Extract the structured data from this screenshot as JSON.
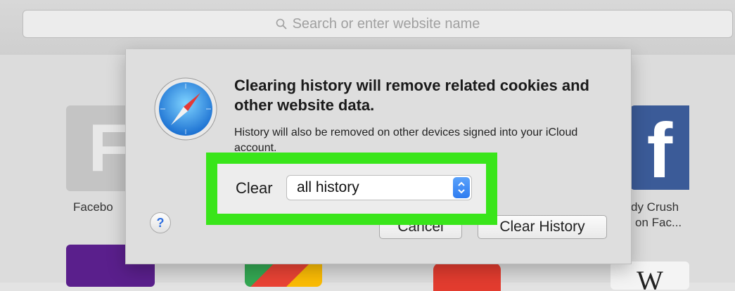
{
  "toolbar": {
    "search_placeholder": "Search or enter website name"
  },
  "favorites": {
    "tile_f_letter": "F",
    "facebook_label": "Facebo",
    "candy_crush_label_line1": "dy Crush",
    "candy_crush_label_line2": "on Fac...",
    "facebook_logo_letter": "f",
    "wiki_letter": "W"
  },
  "dialog": {
    "title": "Clearing history will remove related cookies and other website data.",
    "message": "History will also be removed on other devices signed into your iCloud account.",
    "clear_label": "Clear",
    "clear_option_selected": "all history",
    "help_label": "?",
    "cancel_label": "Cancel",
    "confirm_label": "Clear History"
  },
  "colors": {
    "highlight": "#39e51a",
    "accent": "#2e7cf0"
  }
}
